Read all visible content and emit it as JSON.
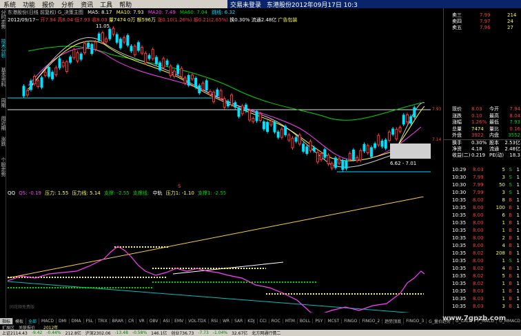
{
  "menu": {
    "items": [
      "系统",
      "功能",
      "报价",
      "分析",
      "资讯",
      "工具",
      "帮助"
    ],
    "login_status": "交易未登录",
    "window_title": "东港股份2012年09月17日 10:3"
  },
  "left_tabs": [
    "分时走势",
    "技术分析",
    "基本资料",
    "周期",
    "用近期",
    "涨跌",
    "个股走势"
  ],
  "stock": {
    "title": "东港股份(日线 前复权) G_决策主图",
    "ma": [
      {
        "label": "MA5: 8.17",
        "color": "#ffffff"
      },
      {
        "label": "MA10: 7.93",
        "color": "#ffff40"
      },
      {
        "label": "MA20: 7.49",
        "color": "#ff40ff"
      },
      {
        "label": "MA60: 7.04",
        "color": "#00d800"
      },
      {
        "label": "跳线: 6.32",
        "color": "#00e0ff"
      }
    ],
    "info": [
      {
        "text": "2012/09/17--",
        "color": "#ffffff"
      },
      {
        "text": "开7.94",
        "color": "#ff3b3b"
      },
      {
        "text": "高8.04",
        "color": "#ff3b3b"
      },
      {
        "text": "低7.93",
        "color": "#ff3b3b"
      },
      {
        "text": "收8.03",
        "color": "#ff3b3b"
      },
      {
        "text": "量7474",
        "color": "#ffff40"
      },
      {
        "text": "0万",
        "color": "#ffff40"
      },
      {
        "text": "额596万",
        "color": "#ffff40"
      },
      {
        "text": "涨0.10(1.26%)",
        "color": "#ff3b3b"
      },
      {
        "text": "振0.21(2.65%)",
        "color": "#ff3b3b"
      },
      {
        "text": "换0.30%",
        "color": "#ffffff"
      },
      {
        "text": "流通2.48亿",
        "color": "#ffffff"
      },
      {
        "text": "广告包装",
        "color": "#ffff40"
      }
    ],
    "high_label": "11.05",
    "range_label": "6.62 - 7.01"
  },
  "price_axis": [
    "7.93",
    "7.14"
  ],
  "indicator": {
    "name": "QQ",
    "params": [
      {
        "text": "QS: -0.19",
        "color": "#ff40ff"
      },
      {
        "text": "压力: 1.55",
        "color": "#ffff40"
      },
      {
        "text": "压力线: 5.14",
        "color": "#ffff40"
      },
      {
        "text": "支撑: -2.55",
        "color": "#00d800"
      },
      {
        "text": "支撑线:",
        "color": "#00d800"
      },
      {
        "text": "中轨",
        "color": "#ffffff"
      },
      {
        "text": "压力1: -1.10",
        "color": "#ffff40"
      },
      {
        "text": "支撑1: -2.55",
        "color": "#00d800"
      }
    ],
    "watermark": "同花顺免费版",
    "axis_left_marker": "S"
  },
  "order_book": {
    "sells": [
      {
        "label": "卖三",
        "price": "7.99",
        "vol": "214"
      },
      {
        "label": "卖四",
        "price": "7.97",
        "vol": "24"
      },
      {
        "label": "卖五",
        "price": "7.96",
        "vol": "27"
      }
    ],
    "top_label": "卖三"
  },
  "quote": [
    {
      "l1": "现价",
      "v1": "8.03",
      "c1": "#ff3b3b",
      "l2": "今开",
      "v2": "7.94",
      "c2": "#ff3b3b"
    },
    {
      "l1": "涨跌",
      "v1": "0.10",
      "c1": "#ff3b3b",
      "l2": "最高",
      "v2": "8.04",
      "c2": "#ff3b3b"
    },
    {
      "l1": "涨幅",
      "v1": "1.26%",
      "c1": "#ff3b3b",
      "l2": "最低",
      "v2": "7.93",
      "c2": "#00d800"
    },
    {
      "l1": "总量",
      "v1": "7474",
      "c1": "#ffff40",
      "l2": "量比",
      "v2": "0.16",
      "c2": "#ff3b3b"
    },
    {
      "l1": "外盘",
      "v1": "3922",
      "c1": "#ff3b3b",
      "l2": "内盘",
      "v2": "3552",
      "c2": "#00d800"
    },
    {
      "l1": "换手",
      "v1": "0.30%",
      "c1": "#ffffff",
      "l2": "股本",
      "v2": "2.53亿",
      "c2": "#ffffff"
    },
    {
      "l1": "净资",
      "v1": "4.18",
      "c1": "#ffffff",
      "l2": "流通",
      "v2": "2.48亿",
      "c2": "#ffffff"
    },
    {
      "l1": "收益(二)",
      "v1": "0.219",
      "c1": "#ffffff",
      "l2": "PE(动)",
      "v2": "18.3",
      "c2": "#ffffff"
    }
  ],
  "ticks": [
    {
      "time": "10:29",
      "price": "8.03",
      "vol": "5",
      "side": "S",
      "n": "1"
    },
    {
      "time": "10:30",
      "price": "7.99",
      "vol": "3",
      "side": "S",
      "n": "1"
    },
    {
      "time": "10:30",
      "price": "7.99",
      "vol": "50",
      "side": "S",
      "n": "1"
    },
    {
      "time": "10:30",
      "price": "7.99",
      "vol": "3",
      "side": "S",
      "n": "1"
    },
    {
      "time": "10:35",
      "price": "8.00",
      "vol": "8",
      "side": "B",
      "n": "1"
    },
    {
      "time": "10:35",
      "price": "8.00",
      "vol": "100",
      "side": "B",
      "n": "1"
    },
    {
      "time": "10:35",
      "price": "8.00",
      "vol": "6",
      "side": "B",
      "n": "1"
    },
    {
      "time": "10:35",
      "price": "8.00",
      "vol": "1",
      "side": "B",
      "n": "1"
    },
    {
      "time": "10:35",
      "price": "8.00",
      "vol": "1",
      "side": "B",
      "n": "1"
    },
    {
      "time": "10:35",
      "price": "8.00",
      "vol": "2",
      "side": "B",
      "n": "1"
    },
    {
      "time": "10:35",
      "price": "8.00",
      "vol": "4",
      "side": "B",
      "n": "1"
    },
    {
      "time": "10:35",
      "price": "8.02",
      "vol": "208",
      "side": "B",
      "n": "1"
    },
    {
      "time": "10:35",
      "price": "8.00",
      "vol": "1",
      "side": "S",
      "n": "1"
    },
    {
      "time": "10:35",
      "price": "8.02",
      "vol": "4",
      "side": "B",
      "n": "1"
    },
    {
      "time": "10:35",
      "price": "8.02",
      "vol": "5",
      "side": "B",
      "n": "1"
    },
    {
      "time": "10:35",
      "price": "8.02",
      "vol": "1",
      "side": "B",
      "n": "1"
    },
    {
      "time": "10:35",
      "price": "8.03",
      "vol": "1",
      "side": "B",
      "n": "1"
    },
    {
      "time": "10:35",
      "price": "8.03",
      "vol": "1",
      "side": "B",
      "n": "1"
    },
    {
      "time": "10:35",
      "price": "8.03",
      "vol": "3",
      "side": "B",
      "n": "1"
    }
  ],
  "bottom_tabs": [
    "指标",
    "模板",
    "全部",
    "MACD",
    "DMI",
    "DMA",
    "FSL",
    "TRIX",
    "BRAR",
    "CR",
    "VR",
    "OBV",
    "ASI",
    "EMV",
    "VOL-TDX",
    "RSI",
    "WR",
    "SAR",
    "KDJ",
    "CCI",
    "ROC",
    "MTM",
    "BOLL",
    "PSY",
    "MCST",
    "FINGO",
    "FINGO_2",
    "趋势顶底",
    "FINGO_3",
    "G_量价趋势",
    "G_CACD",
    "P_MACD",
    "G_MMACD",
    "C_TJ"
  ],
  "sub_tabs": [
    "扩展区",
    "关联报价"
  ],
  "status": [
    {
      "text": "上证2114.43",
      "color": "#000000"
    },
    {
      "text": "-9.42",
      "color": "#008000"
    },
    {
      "text": "-0.44%",
      "color": "#008000"
    },
    {
      "text": "212.8亿",
      "color": "#000000"
    },
    {
      "text": "沪深2302.06",
      "color": "#000000"
    },
    {
      "text": "-13.48",
      "color": "#008000"
    },
    {
      "text": "-0.58%",
      "color": "#008000"
    },
    {
      "text": "146.1亿",
      "color": "#000000"
    },
    {
      "text": "创业736.73",
      "color": "#000000"
    },
    {
      "text": "-7.73",
      "color": "#008000"
    },
    {
      "text": "-1.04%",
      "color": "#008000"
    },
    {
      "text": "32.67亿",
      "color": "#000000"
    },
    {
      "text": "北方网通行情二",
      "color": "#000000"
    }
  ],
  "watermark": "www.7gpzb.com",
  "year_label": "2012年"
}
